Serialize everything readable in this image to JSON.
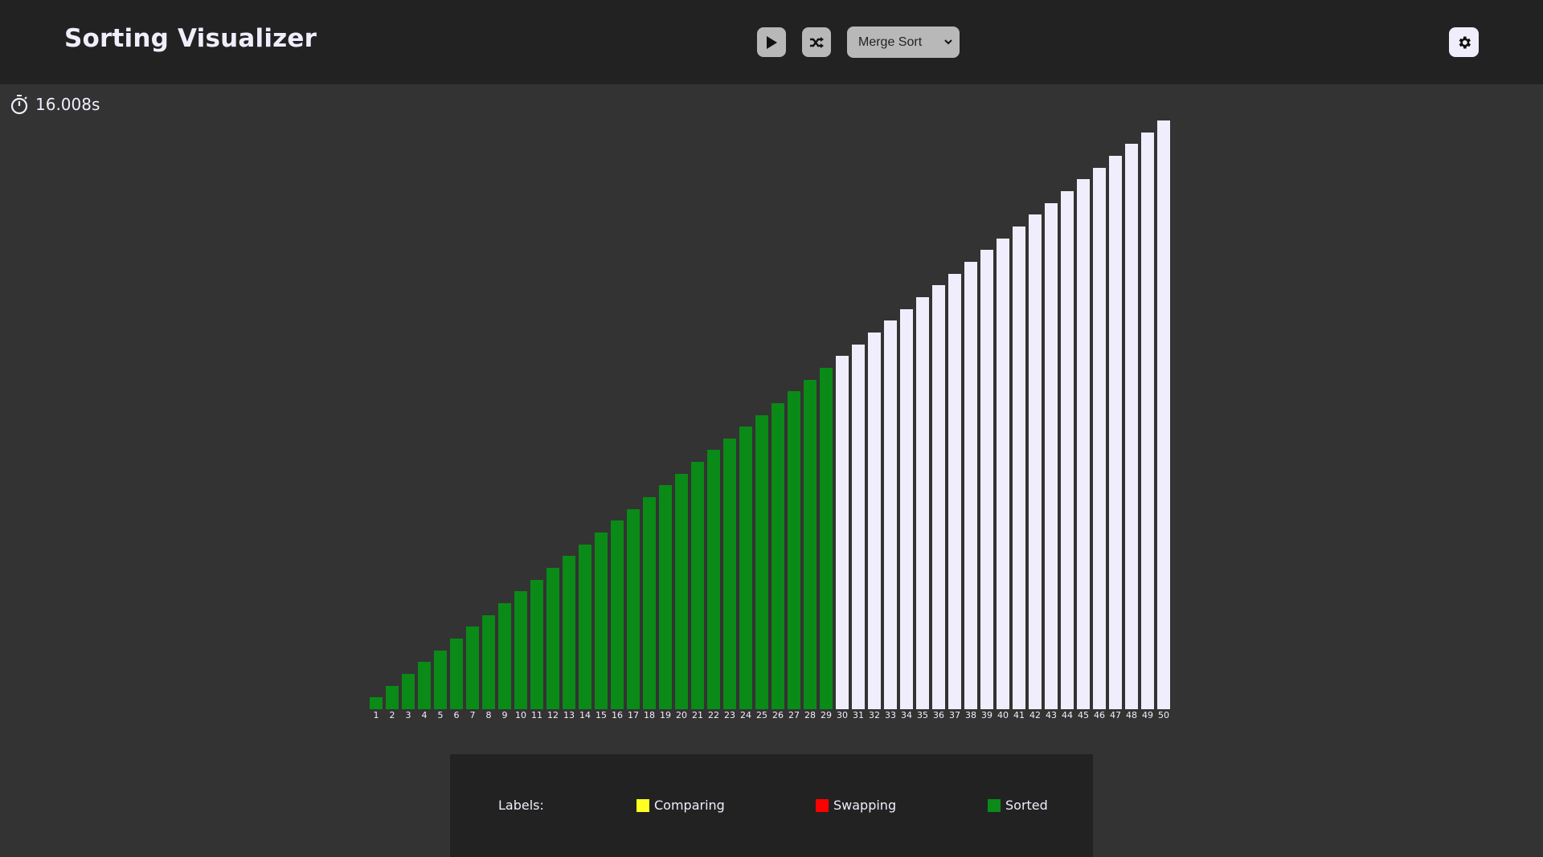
{
  "header": {
    "title": "Sorting Visualizer",
    "play_icon": "play-icon",
    "shuffle_icon": "shuffle-icon",
    "algorithm_select": {
      "selected": "Merge Sort"
    },
    "settings_icon": "gear-icon"
  },
  "timer": {
    "icon": "stopwatch-icon",
    "value": "16.008s"
  },
  "colors": {
    "sorted": "#0a8a16",
    "unsorted": "#f0eefc",
    "comparing": "#ffff22",
    "swapping": "#ff0000"
  },
  "chart_data": {
    "type": "bar",
    "categories": [
      "1",
      "2",
      "3",
      "4",
      "5",
      "6",
      "7",
      "8",
      "9",
      "10",
      "11",
      "12",
      "13",
      "14",
      "15",
      "16",
      "17",
      "18",
      "19",
      "20",
      "21",
      "22",
      "23",
      "24",
      "25",
      "26",
      "27",
      "28",
      "29",
      "30",
      "31",
      "32",
      "33",
      "34",
      "35",
      "36",
      "37",
      "38",
      "39",
      "40",
      "41",
      "42",
      "43",
      "44",
      "45",
      "46",
      "47",
      "48",
      "49",
      "50"
    ],
    "values": [
      1,
      2,
      3,
      4,
      5,
      6,
      7,
      8,
      9,
      10,
      11,
      12,
      13,
      14,
      15,
      16,
      17,
      18,
      19,
      20,
      21,
      22,
      23,
      24,
      25,
      26,
      27,
      28,
      29,
      30,
      31,
      32,
      33,
      34,
      35,
      36,
      37,
      38,
      39,
      40,
      41,
      42,
      43,
      44,
      45,
      46,
      47,
      48,
      49,
      50
    ],
    "states": [
      "sorted",
      "sorted",
      "sorted",
      "sorted",
      "sorted",
      "sorted",
      "sorted",
      "sorted",
      "sorted",
      "sorted",
      "sorted",
      "sorted",
      "sorted",
      "sorted",
      "sorted",
      "sorted",
      "sorted",
      "sorted",
      "sorted",
      "sorted",
      "sorted",
      "sorted",
      "sorted",
      "sorted",
      "sorted",
      "sorted",
      "sorted",
      "sorted",
      "sorted",
      "unsorted",
      "unsorted",
      "unsorted",
      "unsorted",
      "unsorted",
      "unsorted",
      "unsorted",
      "unsorted",
      "unsorted",
      "unsorted",
      "unsorted",
      "unsorted",
      "unsorted",
      "unsorted",
      "unsorted",
      "unsorted",
      "unsorted",
      "unsorted",
      "unsorted",
      "unsorted",
      "unsorted"
    ],
    "ylim": [
      0,
      50
    ],
    "title": "",
    "xlabel": "",
    "ylabel": ""
  },
  "legend": {
    "heading": "Labels:",
    "items": [
      {
        "label": "Comparing",
        "color": "#ffff22"
      },
      {
        "label": "Swapping",
        "color": "#ff0000"
      },
      {
        "label": "Sorted",
        "color": "#0a8a16"
      }
    ]
  }
}
